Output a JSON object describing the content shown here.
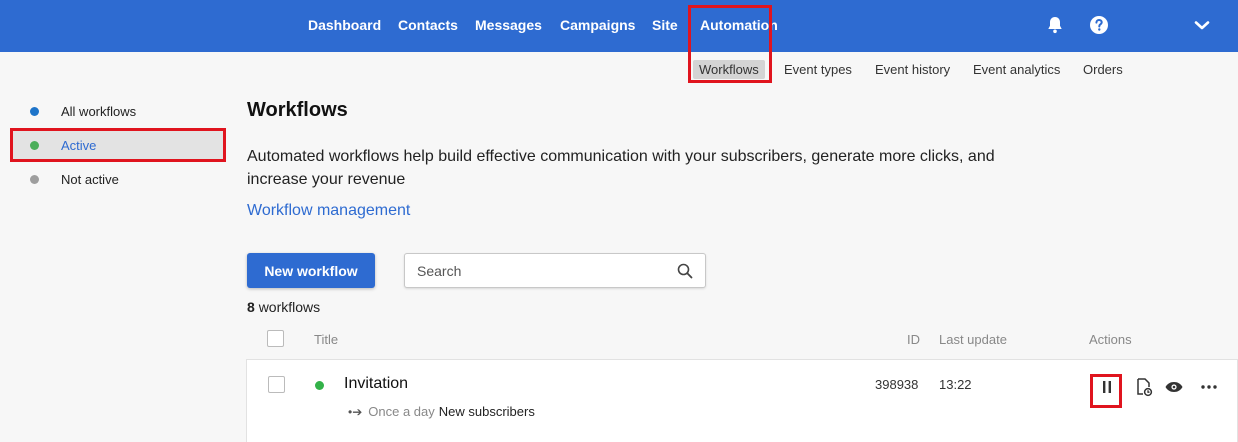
{
  "topnav": {
    "items": [
      "Dashboard",
      "Contacts",
      "Messages",
      "Campaigns",
      "Site",
      "Automation"
    ],
    "icons": [
      "bell-icon",
      "help-icon",
      "chevron-down-icon"
    ]
  },
  "subnav": {
    "items": [
      "Workflows",
      "Event types",
      "Event history",
      "Event analytics",
      "Orders"
    ]
  },
  "sidebar": {
    "items": [
      {
        "label": "All workflows",
        "color": "#1e74c9"
      },
      {
        "label": "Active",
        "color": "#4cae5a"
      },
      {
        "label": "Not active",
        "color": "#9e9e9e"
      }
    ]
  },
  "main": {
    "title": "Workflows",
    "description": "Automated workflows help build effective communication with your subscribers, generate more clicks, and increase your revenue",
    "management_link": "Workflow management",
    "new_button": "New workflow",
    "search_placeholder": "Search",
    "count_number": "8",
    "count_label": "workflows"
  },
  "table": {
    "headers": {
      "title": "Title",
      "id": "ID",
      "last_update": "Last update",
      "actions": "Actions"
    },
    "rows": [
      {
        "name": "Invitation",
        "status_color": "#33b249",
        "schedule": "Once a day",
        "audience": "New subscribers",
        "id": "398938",
        "last_update": "13:22",
        "actions": [
          "pause-icon",
          "document-history-icon",
          "eye-icon",
          "more-icon"
        ]
      }
    ]
  },
  "colors": {
    "brand": "#2e6bd1",
    "highlight": "#e0141e"
  }
}
